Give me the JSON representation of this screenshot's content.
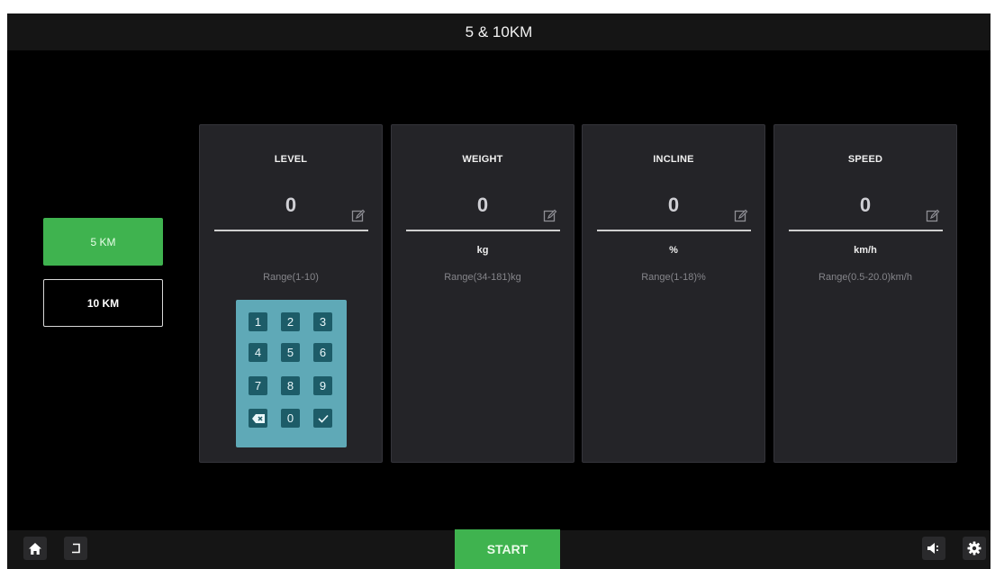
{
  "header": {
    "title": "5 & 10KM"
  },
  "modes": [
    {
      "label": "5 KM",
      "selected": true
    },
    {
      "label": "10 KM",
      "selected": false
    }
  ],
  "cards": [
    {
      "title": "LEVEL",
      "value": "0",
      "unit": "",
      "range": "Range(1-10)"
    },
    {
      "title": "WEIGHT",
      "value": "0",
      "unit": "kg",
      "range": "Range(34-181)kg"
    },
    {
      "title": "INCLINE",
      "value": "0",
      "unit": "%",
      "range": "Range(1-18)%"
    },
    {
      "title": "SPEED",
      "value": "0",
      "unit": "km/h",
      "range": "Range(0.5-20.0)km/h"
    }
  ],
  "keypad": {
    "keys": [
      "1",
      "2",
      "3",
      "4",
      "5",
      "6",
      "7",
      "8",
      "9"
    ],
    "zero": "0",
    "backspace_icon": "backspace-icon",
    "confirm_icon": "check-icon"
  },
  "footer": {
    "start_label": "START",
    "home_icon": "home-icon",
    "back_icon": "back-icon",
    "volume_icon": "volume-icon",
    "settings_icon": "gear-icon"
  },
  "colors": {
    "accent_green": "#3fb34f",
    "keypad_bg": "#5fa9b7",
    "key_bg": "#1d5c68",
    "card_bg": "#242428",
    "bar_bg": "#151515"
  }
}
